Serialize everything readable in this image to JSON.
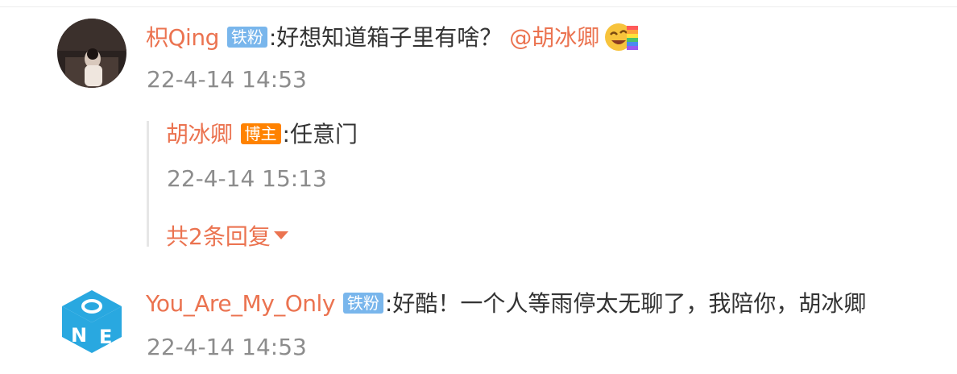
{
  "comments": [
    {
      "username": "枳Qing",
      "badge": "铁粉",
      "text": ":好想知道箱子里有啥？",
      "mention": "@胡冰卿",
      "emoji_icon": "laughing-face-emoji-icon",
      "time": "22-4-14 14:53"
    },
    {
      "username": "You_Are_My_Only",
      "badge": "铁粉",
      "text": ":好酷！一个人等雨停太无聊了，我陪你，胡冰卿",
      "time": "22-4-14 14:53"
    }
  ],
  "reply": {
    "username": "胡冰卿",
    "badge": "博主",
    "text": ":任意门",
    "time": "22-4-14 15:13",
    "more_label": "共2条回复"
  },
  "colors": {
    "username": "#eb7350",
    "fan_badge": "#79b6ec",
    "author_badge": "#ff8200",
    "timestamp": "#8c8c8c",
    "text": "#333333"
  }
}
